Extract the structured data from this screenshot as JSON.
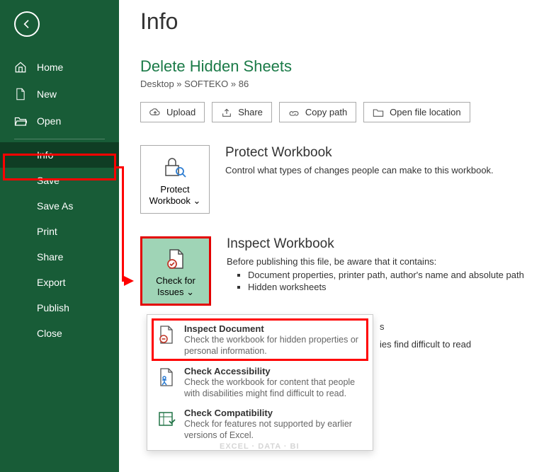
{
  "sidebar": {
    "items": [
      {
        "label": "Home",
        "icon": "home"
      },
      {
        "label": "New",
        "icon": "new"
      },
      {
        "label": "Open",
        "icon": "open"
      }
    ],
    "file_items": [
      {
        "label": "Info",
        "selected": true
      },
      {
        "label": "Save"
      },
      {
        "label": "Save As"
      },
      {
        "label": "Print"
      },
      {
        "label": "Share"
      },
      {
        "label": "Export"
      },
      {
        "label": "Publish"
      },
      {
        "label": "Close"
      }
    ]
  },
  "page": {
    "title": "Info",
    "document_title": "Delete Hidden Sheets",
    "breadcrumb": "Desktop » SOFTEKO » 86"
  },
  "actions": [
    {
      "label": "Upload",
      "icon": "upload"
    },
    {
      "label": "Share",
      "icon": "share"
    },
    {
      "label": "Copy path",
      "icon": "link"
    },
    {
      "label": "Open file location",
      "icon": "folder"
    }
  ],
  "protect": {
    "button_label": "Protect Workbook ⌄",
    "heading": "Protect Workbook",
    "desc": "Control what types of changes people can make to this workbook."
  },
  "inspect": {
    "button_label": "Check for Issues ⌄",
    "heading": "Inspect Workbook",
    "intro": "Before publishing this file, be aware that it contains:",
    "bullets": [
      "Document properties, printer path, author's name and absolute path",
      "Hidden worksheets"
    ]
  },
  "inspect_extra": {
    "line1": "s",
    "line2": "ies find difficult to read"
  },
  "popup": [
    {
      "title": "Inspect Document",
      "desc": "Check the workbook for hidden properties or personal information.",
      "icon": "inspect"
    },
    {
      "title": "Check Accessibility",
      "desc": "Check the workbook for content that people with disabilities might find difficult to read.",
      "icon": "access"
    },
    {
      "title": "Check Compatibility",
      "desc": "Check for features not supported by earlier versions of Excel.",
      "icon": "compat"
    }
  ],
  "watermark": "EXCEL · DATA · BI"
}
